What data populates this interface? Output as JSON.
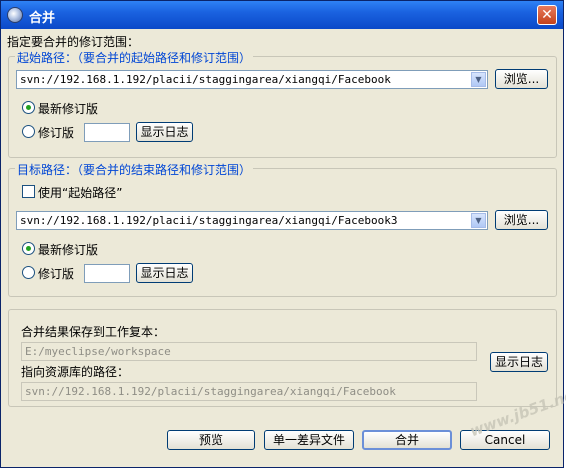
{
  "window": {
    "title": "合并",
    "close_label": "✕"
  },
  "main": {
    "instruction": "指定要合并的修订范围："
  },
  "start_group": {
    "title": "起始路径：（要合并的起始路径和修订范围）",
    "path": "svn://192.168.1.192/placii/staggingarea/xiangqi/Facebook",
    "browse_label": "浏览...",
    "latest_label": "最新修订版",
    "revision_label": "修订版",
    "revision_value": "",
    "show_log_label": "显示日志",
    "selected": "latest"
  },
  "target_group": {
    "title": "目标路径：（要合并的结束路径和修订范围）",
    "use_start_label": "使用“起始路径”",
    "use_start_checked": false,
    "path": "svn://192.168.1.192/placii/staggingarea/xiangqi/Facebook3",
    "browse_label": "浏览...",
    "latest_label": "最新修订版",
    "revision_label": "修订版",
    "revision_value": "",
    "show_log_label": "显示日志",
    "selected": "latest"
  },
  "result_group": {
    "save_label": "合并结果保存到工作复本：",
    "working_copy": "E:/myeclipse/workspace",
    "repo_label": "指向资源库的路径：",
    "repo_path": "svn://192.168.1.192/placii/staggingarea/xiangqi/Facebook",
    "show_log_label": "显示日志"
  },
  "buttons": {
    "preview": "预览",
    "unified_diff": "单一差异文件",
    "merge": "合并",
    "cancel": "Cancel"
  },
  "watermark": "www.jb51.net"
}
